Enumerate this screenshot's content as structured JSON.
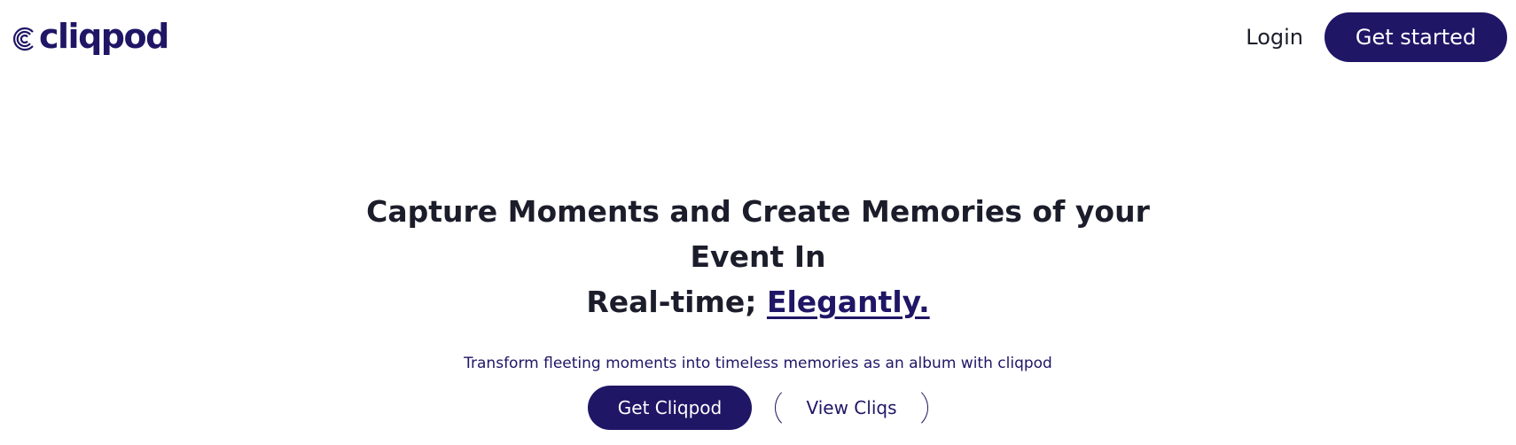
{
  "header": {
    "logo_text": "cliqpod",
    "login_label": "Login",
    "get_started_label": "Get started"
  },
  "hero": {
    "headline_line1": "Capture Moments and Create Memories of your Event In",
    "headline_line2_prefix": "Real-time; ",
    "headline_accent": "Elegantly.",
    "subtitle": "Transform fleeting moments into timeless memories as an album with cliqpod",
    "primary_cta": "Get Cliqpod",
    "secondary_cta": "View Cliqs"
  },
  "colors": {
    "brand": "#1f1666",
    "text_dark": "#1c1d2b",
    "background": "#ffffff"
  }
}
